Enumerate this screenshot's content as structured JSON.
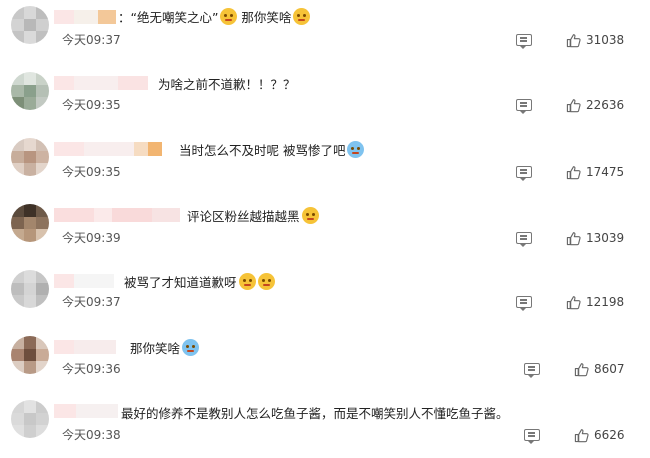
{
  "comments": [
    {
      "parts": [
        {
          "type": "text",
          "value": "：“绝无嘲笑之心”"
        },
        {
          "type": "emoji",
          "name": "thinking-emoji"
        },
        {
          "type": "text",
          "value": " 那你笑啥"
        },
        {
          "type": "emoji",
          "name": "thinking-emoji"
        }
      ],
      "time": "今天09:37",
      "likes": "31038"
    },
    {
      "parts": [
        {
          "type": "text",
          "value": "为啥之前不道歉！！？？"
        }
      ],
      "time": "今天09:35",
      "likes": "22636"
    },
    {
      "parts": [
        {
          "type": "text",
          "value": "当时怎么不及时呢 被骂惨了吧"
        },
        {
          "type": "emoji",
          "name": "sweat-emoji"
        }
      ],
      "time": "今天09:35",
      "likes": "17475"
    },
    {
      "parts": [
        {
          "type": "text",
          "value": "评论区粉丝越描越黑"
        },
        {
          "type": "emoji",
          "name": "smile-emoji"
        }
      ],
      "time": "今天09:39",
      "likes": "13039"
    },
    {
      "parts": [
        {
          "type": "text",
          "value": "被骂了才知道道歉呀"
        },
        {
          "type": "emoji",
          "name": "shocked-emoji"
        },
        {
          "type": "emoji",
          "name": "shocked-emoji"
        }
      ],
      "time": "今天09:37",
      "likes": "12198"
    },
    {
      "parts": [
        {
          "type": "text",
          "value": "那你笑啥"
        },
        {
          "type": "emoji",
          "name": "facepalm-emoji"
        }
      ],
      "time": "今天09:36",
      "likes": "8607"
    },
    {
      "parts": [
        {
          "type": "text",
          "value": "最好的修养不是教别人怎么吃鱼子酱，而是不嘲笑别人不懂吃鱼子酱。"
        }
      ],
      "time": "今天09:38",
      "likes": "6626"
    }
  ]
}
